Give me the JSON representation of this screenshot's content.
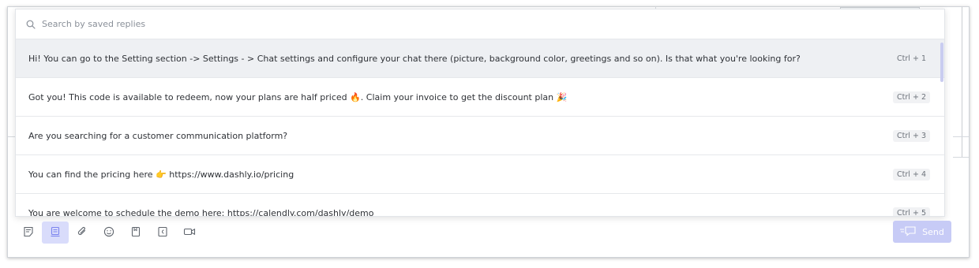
{
  "search": {
    "placeholder": "Search by saved replies",
    "value": ""
  },
  "replies": [
    {
      "text": "Hi! You can go to the Setting section -> Settings - > Chat settings and configure your chat there (picture, background color, greetings and so on). Is that what you're looking for?",
      "shortcut": "Ctrl + 1",
      "active": true
    },
    {
      "text": "Got you! This code is available to redeem, now your plans are half priced 🔥. Claim your invoice to get the discount plan 🎉",
      "shortcut": "Ctrl + 2",
      "active": false
    },
    {
      "text": "Are you searching for a customer communication platform?",
      "shortcut": "Ctrl + 3",
      "active": false
    },
    {
      "text": "You can find the pricing here 👉 https://www.dashly.io/pricing",
      "shortcut": "Ctrl + 4",
      "active": false
    },
    {
      "text": "You are welcome to schedule the demo here: https://calendly.com/dashly/demo",
      "shortcut": "Ctrl + 5",
      "active": false
    }
  ],
  "toolbar": {
    "tools": [
      {
        "icon": "note-icon",
        "active": false
      },
      {
        "icon": "saved-replies-icon",
        "active": true
      },
      {
        "icon": "paperclip-icon",
        "active": false
      },
      {
        "icon": "emoji-icon",
        "active": false
      },
      {
        "icon": "article-icon",
        "active": false
      },
      {
        "icon": "template-icon",
        "active": false
      },
      {
        "icon": "video-icon",
        "active": false
      }
    ],
    "send_label": "Send"
  },
  "colors": {
    "accent": "#7c84ef",
    "accent_light": "#d9dcfb",
    "send_disabled": "#c7cbf6",
    "active_row": "#eef0f3"
  }
}
